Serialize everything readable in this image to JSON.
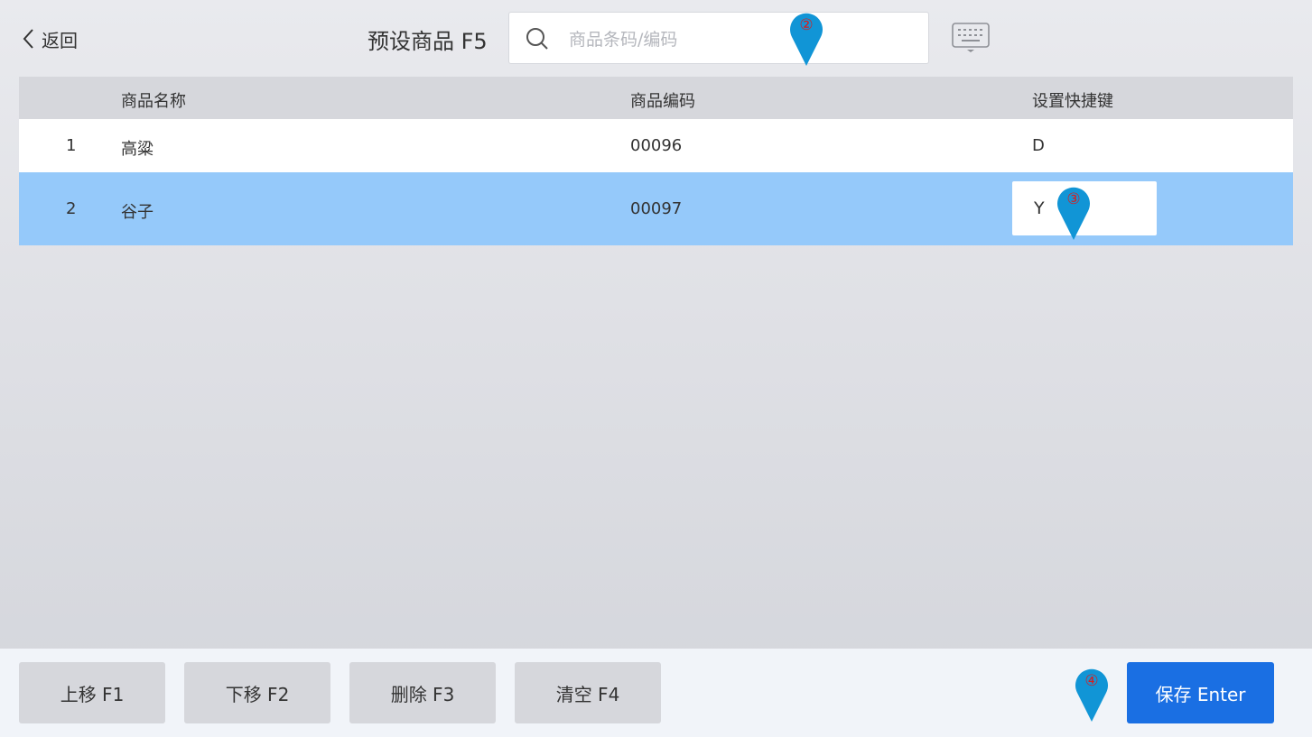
{
  "header": {
    "back_label": "返回",
    "title": "预设商品 F5",
    "search_placeholder": "商品条码/编码"
  },
  "table": {
    "columns": [
      "商品名称",
      "商品编码",
      "设置快捷键"
    ],
    "rows": [
      {
        "index": "1",
        "name": "高粱",
        "code": "00096",
        "shortcut": "D"
      },
      {
        "index": "2",
        "name": "谷子",
        "code": "00097",
        "shortcut": "Y"
      }
    ]
  },
  "markers": {
    "search": "②",
    "shortcut": "③",
    "save": "④",
    "color": "#1195d6"
  },
  "footer": {
    "move_up": "上移 F1",
    "move_down": "下移 F2",
    "delete": "删除 F3",
    "clear": "清空 F4",
    "save": "保存 Enter"
  },
  "colors": {
    "selected_row": "#95c9fa",
    "save_button": "#1a6fe3",
    "header_row": "#d6d7dc"
  }
}
